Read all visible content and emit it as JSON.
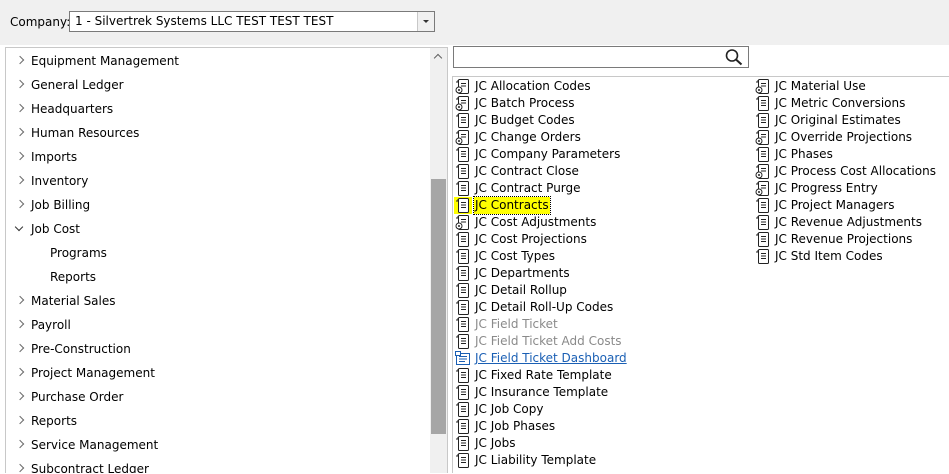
{
  "company": {
    "label": "Company:",
    "value": "1 - Silvertrek Systems LLC TEST TEST TEST"
  },
  "tree": {
    "items": [
      {
        "label": "Equipment Management",
        "state": "collapsed"
      },
      {
        "label": "General Ledger",
        "state": "collapsed"
      },
      {
        "label": "Headquarters",
        "state": "collapsed"
      },
      {
        "label": "Human Resources",
        "state": "collapsed"
      },
      {
        "label": "Imports",
        "state": "collapsed"
      },
      {
        "label": "Inventory",
        "state": "collapsed"
      },
      {
        "label": "Job Billing",
        "state": "collapsed"
      },
      {
        "label": "Job Cost",
        "state": "expanded"
      },
      {
        "label": "Programs",
        "state": "child"
      },
      {
        "label": "Reports",
        "state": "child"
      },
      {
        "label": "Material Sales",
        "state": "collapsed"
      },
      {
        "label": "Payroll",
        "state": "collapsed"
      },
      {
        "label": "Pre-Construction",
        "state": "collapsed"
      },
      {
        "label": "Project Management",
        "state": "collapsed"
      },
      {
        "label": "Purchase Order",
        "state": "collapsed"
      },
      {
        "label": "Reports",
        "state": "collapsed"
      },
      {
        "label": "Service Management",
        "state": "collapsed"
      },
      {
        "label": "Subcontract Ledger",
        "state": "collapsed"
      }
    ]
  },
  "search": {
    "placeholder": "",
    "icon": "search-icon"
  },
  "programs": {
    "column1": [
      {
        "label": "JC Allocation Codes",
        "icon": "process-form-icon",
        "state": "normal"
      },
      {
        "label": "JC Batch Process",
        "icon": "process-form-icon",
        "state": "normal"
      },
      {
        "label": "JC Budget Codes",
        "icon": "form-icon",
        "state": "normal"
      },
      {
        "label": "JC Change Orders",
        "icon": "process-form-icon",
        "state": "normal"
      },
      {
        "label": "JC Company Parameters",
        "icon": "form-icon",
        "state": "normal"
      },
      {
        "label": "JC Contract Close",
        "icon": "form-icon",
        "state": "normal"
      },
      {
        "label": "JC Contract Purge",
        "icon": "form-icon",
        "state": "normal"
      },
      {
        "label": "JC Contracts",
        "icon": "form-icon",
        "state": "selected"
      },
      {
        "label": "JC Cost Adjustments",
        "icon": "process-form-icon",
        "state": "normal"
      },
      {
        "label": "JC Cost Projections",
        "icon": "form-icon",
        "state": "normal"
      },
      {
        "label": "JC Cost Types",
        "icon": "form-icon",
        "state": "normal"
      },
      {
        "label": "JC Departments",
        "icon": "form-icon",
        "state": "normal"
      },
      {
        "label": "JC Detail Rollup",
        "icon": "form-icon",
        "state": "normal"
      },
      {
        "label": "JC Detail Roll-Up Codes",
        "icon": "form-icon",
        "state": "normal"
      },
      {
        "label": "JC Field Ticket",
        "icon": "form-icon",
        "state": "disabled"
      },
      {
        "label": "JC Field Ticket Add Costs",
        "icon": "form-icon",
        "state": "disabled"
      },
      {
        "label": "JC Field Ticket Dashboard",
        "icon": "dashboard-icon",
        "state": "link"
      },
      {
        "label": "JC Fixed Rate Template",
        "icon": "form-icon",
        "state": "normal"
      },
      {
        "label": "JC Insurance Template",
        "icon": "form-icon",
        "state": "normal"
      },
      {
        "label": "JC Job Copy",
        "icon": "form-icon",
        "state": "normal"
      },
      {
        "label": "JC Job Phases",
        "icon": "form-icon",
        "state": "normal"
      },
      {
        "label": "JC Jobs",
        "icon": "form-icon",
        "state": "normal"
      },
      {
        "label": "JC Liability Template",
        "icon": "form-icon",
        "state": "normal"
      }
    ],
    "column2": [
      {
        "label": "JC Material Use",
        "icon": "process-form-icon",
        "state": "normal"
      },
      {
        "label": "JC Metric Conversions",
        "icon": "form-icon",
        "state": "normal"
      },
      {
        "label": "JC Original Estimates",
        "icon": "form-icon",
        "state": "normal"
      },
      {
        "label": "JC Override Projections",
        "icon": "process-form-icon",
        "state": "normal"
      },
      {
        "label": "JC Phases",
        "icon": "form-icon",
        "state": "normal"
      },
      {
        "label": "JC Process Cost Allocations",
        "icon": "process-form-icon",
        "state": "normal"
      },
      {
        "label": "JC Progress Entry",
        "icon": "process-form-icon",
        "state": "normal"
      },
      {
        "label": "JC Project Managers",
        "icon": "form-icon",
        "state": "normal"
      },
      {
        "label": "JC Revenue Adjustments",
        "icon": "form-icon",
        "state": "normal"
      },
      {
        "label": "JC Revenue Projections",
        "icon": "form-icon",
        "state": "normal"
      },
      {
        "label": "JC Std Item Codes",
        "icon": "form-icon",
        "state": "normal"
      }
    ]
  }
}
